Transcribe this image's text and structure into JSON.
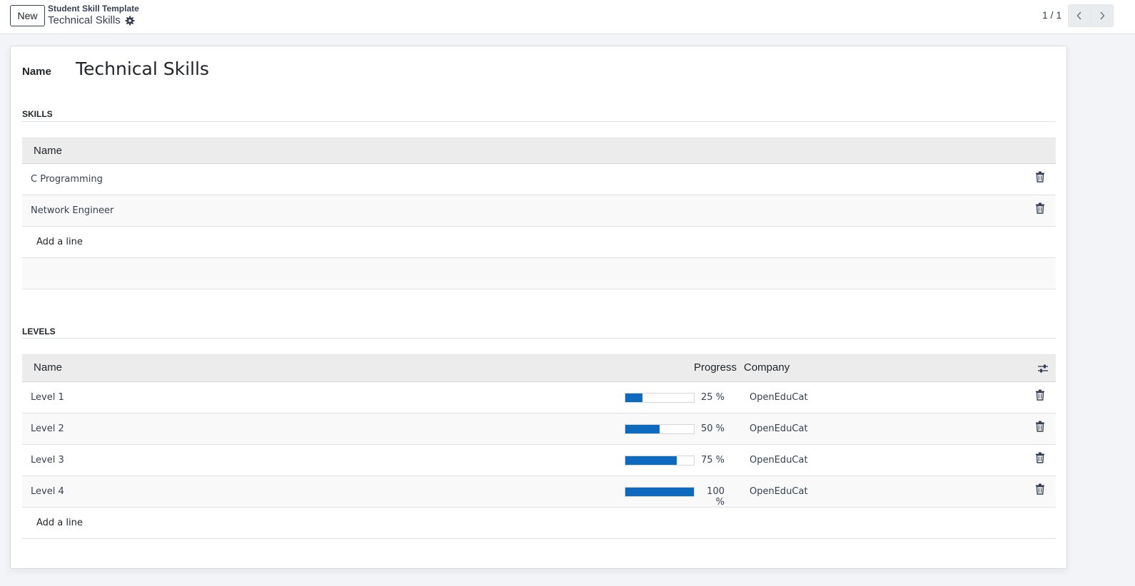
{
  "control_panel": {
    "new_label": "New",
    "breadcrumb_parent": "Student Skill Template",
    "breadcrumb_current": "Technical Skills",
    "pager_value": "1 / 1"
  },
  "form": {
    "name_label": "Name",
    "name_value": "Technical Skills"
  },
  "skills": {
    "section_title": "SKILLS",
    "column_name": "Name",
    "rows": [
      {
        "name": "C Programming"
      },
      {
        "name": "Network Engineer"
      }
    ],
    "add_line": "Add a line"
  },
  "levels": {
    "section_title": "LEVELS",
    "columns": {
      "name": "Name",
      "progress": "Progress",
      "company": "Company"
    },
    "rows": [
      {
        "name": "Level 1",
        "progress": 25,
        "progress_text": "25 %",
        "company": "OpenEduCat"
      },
      {
        "name": "Level 2",
        "progress": 50,
        "progress_text": "50 %",
        "company": "OpenEduCat"
      },
      {
        "name": "Level 3",
        "progress": 75,
        "progress_text": "75 %",
        "company": "OpenEduCat"
      },
      {
        "name": "Level 4",
        "progress": 100,
        "progress_text": "100 %",
        "company": "OpenEduCat"
      }
    ],
    "add_line": "Add a line"
  },
  "colors": {
    "progress_fill": "#0d6abf",
    "header_bg": "#ececec"
  },
  "icons": {
    "gear": "gear-icon",
    "prev": "chevron-left-icon",
    "next": "chevron-right-icon",
    "delete": "trash-icon",
    "optional_columns": "sliders-icon"
  }
}
